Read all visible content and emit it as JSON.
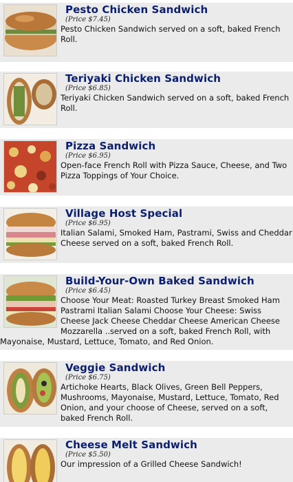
{
  "menu": {
    "items": [
      {
        "title": "Pesto Chicken Sandwich",
        "price": "(Price $7.45)",
        "description": "Pesto Chicken Sandwich served on a soft, baked French Roll."
      },
      {
        "title": "Teriyaki Chicken Sandwich",
        "price": "(Price $6.85)",
        "description": "Teriyaki Chicken Sandwich served on a soft, baked French Roll."
      },
      {
        "title": "Pizza Sandwich",
        "price": "(Price $6.95)",
        "description": "Open-face French Roll with Pizza Sauce, Cheese, and Two Pizza Toppings of Your Choice."
      },
      {
        "title": "Village Host Special",
        "price": "(Price $6.95)",
        "description": "Italian Salami, Smoked Ham, Pastrami, Swiss and Cheddar Cheese served on a soft, baked French Roll."
      },
      {
        "title": "Build-Your-Own Baked Sandwich",
        "price": "(Price $6.45)",
        "description": "Choose Your Meat: Roasted Turkey Breast Smoked Ham Pastrami Italian Salami Choose Your Cheese: Swiss Cheese Jack Cheese Cheddar Cheese American Cheese Mozzarella ..served on a soft, baked French Roll, with Mayonaise, Mustard, Lettuce, Tomato, and Red Onion."
      },
      {
        "title": "Veggie Sandwich",
        "price": "(Price $6.75)",
        "description": "Artichoke Hearts, Black Olives, Green Bell Peppers, Mushrooms, Mayonaise, Mustard, Lettuce, Tomato, Red Onion, and your choose of Cheese, served on a soft, baked French Roll."
      },
      {
        "title": "Cheese Melt Sandwich",
        "price": "(Price $5.50)",
        "description": "Our impression of a Grilled Cheese Sandwich!"
      }
    ]
  }
}
